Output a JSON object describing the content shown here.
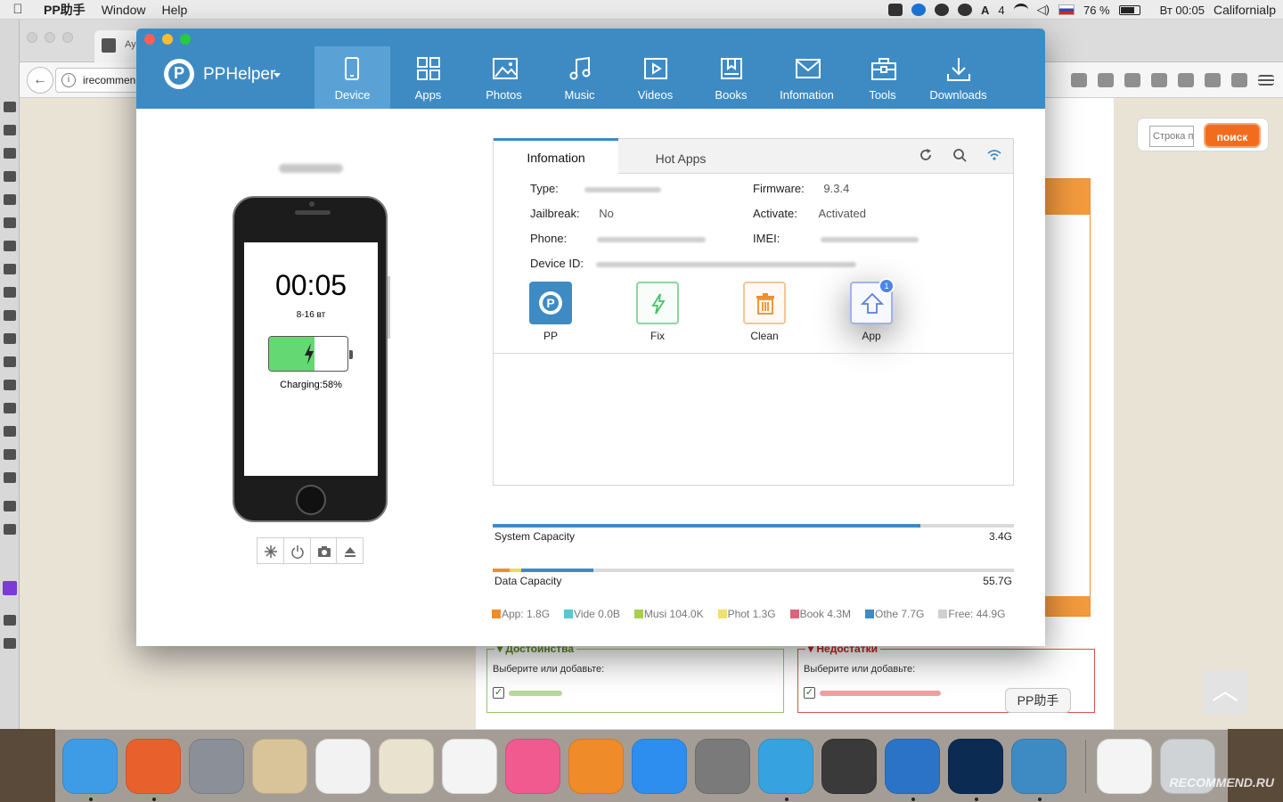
{
  "menubar": {
    "app_name": "PP助手",
    "menus": [
      "Window",
      "Help"
    ],
    "right": {
      "badge_count": "4",
      "battery_percent": "76 %",
      "clock": "Вт 00:05",
      "user": "Californialp"
    }
  },
  "browser": {
    "tab_title": "Ay",
    "url": "irecommen",
    "search_placeholder": "Строка п",
    "search_button": "поиск",
    "pros_title": "Достоинства",
    "cons_title": "Недостатки",
    "pros_hint": "Выберите или добавьте:",
    "cons_hint": "Выберите или добавьте:",
    "scroll_up": "︿"
  },
  "app": {
    "brand": "PPHelper",
    "nav": [
      {
        "label": "Device",
        "icon": "device-icon",
        "active": true
      },
      {
        "label": "Apps",
        "icon": "apps-grid-icon"
      },
      {
        "label": "Photos",
        "icon": "photos-icon"
      },
      {
        "label": "Music",
        "icon": "music-note-icon"
      },
      {
        "label": "Videos",
        "icon": "video-play-icon"
      },
      {
        "label": "Books",
        "icon": "books-icon"
      },
      {
        "label": "Infomation",
        "icon": "mail-icon"
      },
      {
        "label": "Tools",
        "icon": "toolbox-icon"
      },
      {
        "label": "Downloads",
        "icon": "download-icon"
      }
    ],
    "phone": {
      "time": "00:05",
      "date": "8-16 вт",
      "charging": "Charging:58%",
      "battery_level": 0.58
    },
    "info": {
      "tabs": [
        "Infomation",
        "Hot Apps"
      ],
      "type_label": "Type:",
      "jailbreak_label": "Jailbreak:",
      "jailbreak_value": "No",
      "phone_label": "Phone:",
      "device_id_label": "Device ID:",
      "firmware_label": "Firmware:",
      "firmware_value": "9.3.4",
      "activate_label": "Activate:",
      "activate_value": "Activated",
      "imei_label": "IMEI:",
      "tools": [
        {
          "label": "PP",
          "icon": "pp-logo-icon"
        },
        {
          "label": "Fix",
          "icon": "lightning-icon"
        },
        {
          "label": "Clean",
          "icon": "trash-icon"
        },
        {
          "label": "App",
          "icon": "upload-home-icon",
          "badge": "1"
        }
      ]
    },
    "capacity": {
      "system_label": "System Capacity",
      "system_value": "3.4G",
      "system_fill": 0.82,
      "data_label": "Data Capacity",
      "data_value": "55.7G",
      "data_segments": [
        {
          "color": "#ef8d2c",
          "fraction": 0.032
        },
        {
          "color": "#e8dd5a",
          "fraction": 0.023
        },
        {
          "color": "#3e8bc4",
          "fraction": 0.138
        }
      ],
      "legend": [
        {
          "text": "App: 1.8G",
          "color": "#ef8d2c"
        },
        {
          "text": "Vide 0.0B",
          "color": "#5bc6cf"
        },
        {
          "text": "Musi 104.0K",
          "color": "#a9cf4d"
        },
        {
          "text": "Phot 1.3G",
          "color": "#f1e06a"
        },
        {
          "text": "Book 4.3M",
          "color": "#e0627a"
        },
        {
          "text": "Othe 7.7G",
          "color": "#3e8bc4"
        },
        {
          "text": "Free: 44.9G",
          "color": "#d0d0d0"
        }
      ]
    }
  },
  "dock": {
    "tooltip": "PP助手",
    "items": [
      {
        "name": "finder-icon",
        "color": "#3e9be6",
        "running": true
      },
      {
        "name": "firefox-icon",
        "color": "#e8612c",
        "running": true
      },
      {
        "name": "launchpad-icon",
        "color": "#8a8f98",
        "running": false
      },
      {
        "name": "mail-icon",
        "color": "#d9c49a",
        "running": false
      },
      {
        "name": "calendar-icon",
        "color": "#f2f2f2",
        "running": false
      },
      {
        "name": "contacts-icon",
        "color": "#e9e2cf",
        "running": false
      },
      {
        "name": "photos-icon",
        "color": "#f4f4f4",
        "running": false
      },
      {
        "name": "itunes-icon",
        "color": "#f05a8f",
        "running": false
      },
      {
        "name": "ibooks-icon",
        "color": "#f08b2a",
        "running": false
      },
      {
        "name": "app-store-icon",
        "color": "#2d8ef0",
        "running": false
      },
      {
        "name": "system-preferences-icon",
        "color": "#7a7a7a",
        "running": false
      },
      {
        "name": "telegram-icon",
        "color": "#36a3e0",
        "running": true
      },
      {
        "name": "image-capture-icon",
        "color": "#3a3a3a",
        "running": false
      },
      {
        "name": "word-icon",
        "color": "#2b73c6",
        "running": true
      },
      {
        "name": "photoshop-icon",
        "color": "#0c2b52",
        "running": true
      },
      {
        "name": "pphelper-icon",
        "color": "#3e8bc4",
        "running": true
      }
    ],
    "after_separator": [
      {
        "name": "document-icon",
        "color": "#f4f4f4"
      },
      {
        "name": "trash-icon",
        "color": "#cfd3d6"
      }
    ],
    "watermark": "RECOMMEND.RU"
  }
}
